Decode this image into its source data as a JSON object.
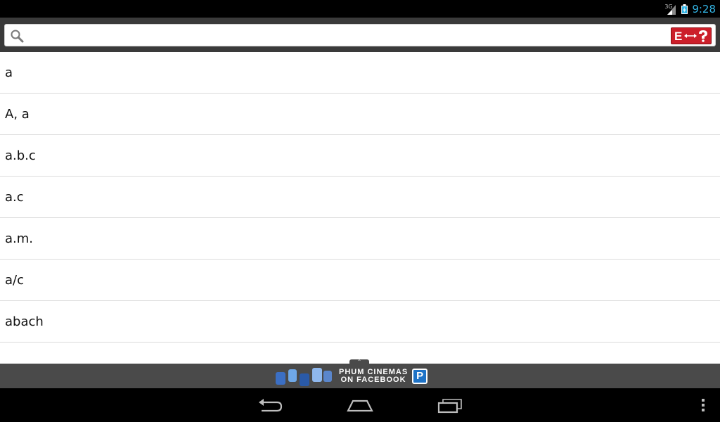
{
  "status_bar": {
    "network": "3G",
    "time": "9:28"
  },
  "search": {
    "value": "",
    "placeholder": ""
  },
  "words": [
    "a",
    "A, a",
    "a.b.c",
    "a.c",
    "a.m.",
    "a/c",
    "abach"
  ],
  "ad": {
    "line1": "PHUM CINEMAS",
    "line2": "ON FACEBOOK",
    "badge": "P",
    "logo_text": "Like"
  },
  "colors": {
    "status_clock": "#33b5e5",
    "search_area_bg": "#3a3a3a",
    "lang_toggle_bg": "#cc1f2a",
    "ad_bg": "#4a4a4a",
    "ad_badge": "#1e73c7"
  },
  "icons": {
    "search": "search-icon",
    "lang_toggle": "english-khmer-toggle-icon",
    "back": "back-icon",
    "home": "home-icon",
    "recents": "recent-apps-icon",
    "menu": "overflow-menu-icon"
  }
}
